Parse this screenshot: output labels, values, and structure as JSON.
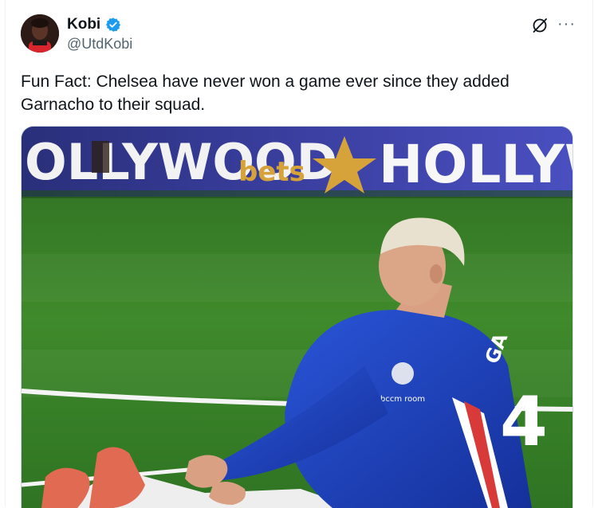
{
  "author": {
    "display_name": "Kobi",
    "handle": "@UtdKobi",
    "verified": true,
    "avatar": "profile-avatar"
  },
  "tweet": {
    "text": "Fun Fact: Chelsea have never won a game ever since they added Garnacho to their squad."
  },
  "media": {
    "image": "photo-player-sitting-on-pitch",
    "banner_text_left": "OLLYWOOD",
    "banner_text_mid": "bets",
    "banner_text_right": "HOLLYW",
    "shirt_name": "GA",
    "shirt_number": "4",
    "sponsor": "bccm\nroom"
  },
  "icons": {
    "verified": "verified-badge-icon",
    "grok": "grok-icon",
    "more": "more-options-icon"
  },
  "colors": {
    "verified_blue": "#1d9bf0",
    "handle_gray": "#536471",
    "pitch_green": "#3f8a2b",
    "shirt_blue": "#1c3fbf"
  }
}
